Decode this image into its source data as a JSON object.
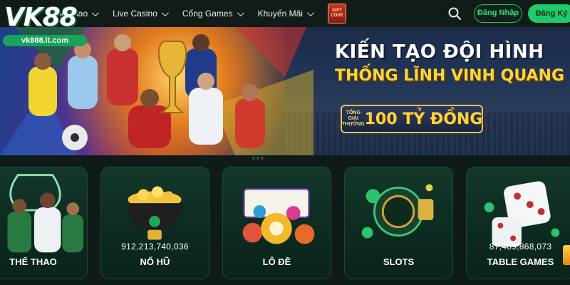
{
  "brand": {
    "logo_text": "VK88",
    "domain": "vk888.it.com"
  },
  "nav": {
    "items": [
      {
        "label": "Thể Thao"
      },
      {
        "label": "Live Casino"
      },
      {
        "label": "Cổng Games"
      },
      {
        "label": "Khuyến Mãi"
      }
    ],
    "gift_line1": "GIFT",
    "gift_line2": "CODE"
  },
  "auth": {
    "login_label": "Đăng Nhập",
    "register_label": "Đăng Ký"
  },
  "banner": {
    "headline": "KIẾN TẠO ĐỘI HÌNH",
    "subheadline": "THỐNG LĨNH VINH QUANG",
    "prize_caption": "TỔNG GIẢI THƯỞNG",
    "prize_amount": "100 TỶ ĐỒNG"
  },
  "categories": [
    {
      "label": "THỂ THAO",
      "value": ""
    },
    {
      "label": "NỔ HŨ",
      "value": "912,213,740,036"
    },
    {
      "label": "LÔ ĐỀ",
      "value": ""
    },
    {
      "label": "SLOTS",
      "value": ""
    },
    {
      "label": "TABLE GAMES",
      "value": "87,489,868,073"
    }
  ],
  "colors": {
    "accent": "#1ecb6b",
    "gold": "#ffd53a",
    "background": "#0f1b18"
  }
}
